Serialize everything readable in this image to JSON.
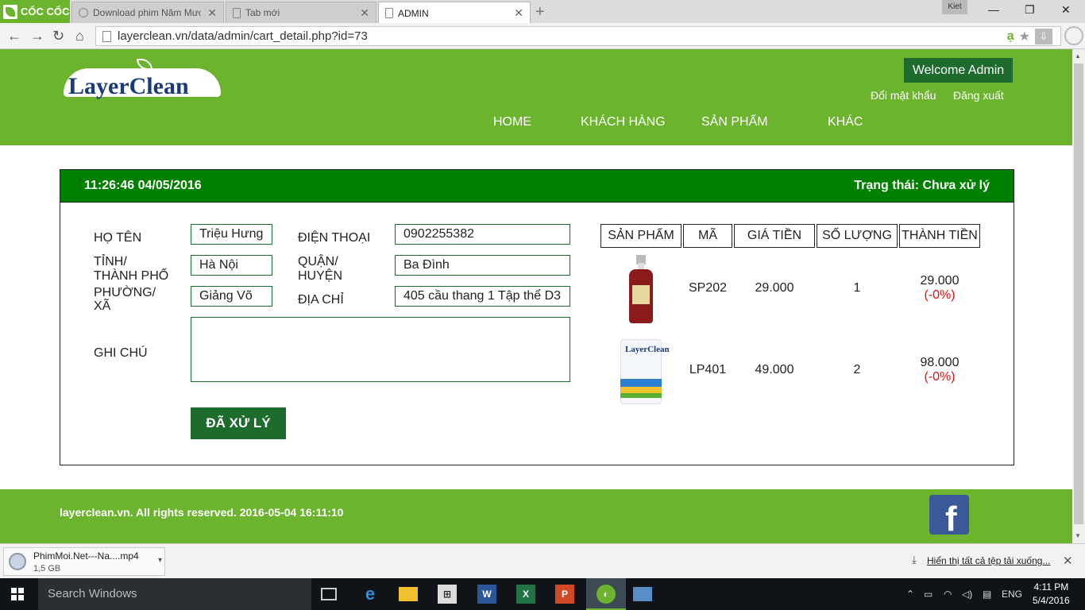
{
  "browser": {
    "brand": "CỐC CỐC",
    "tabs": [
      {
        "label": "Download phim Năm Mươ"
      },
      {
        "label": "Tab mới"
      },
      {
        "label": "ADMIN"
      }
    ],
    "user_badge": "Kiet",
    "url": "layerclean.vn/data/admin/cart_detail.php?id=73"
  },
  "site": {
    "logo_text": "LayerClean",
    "welcome": "Welcome Admin",
    "account_links": {
      "change_password": "Đổi mật khẩu",
      "logout": "Đăng xuất"
    },
    "nav": {
      "home": "HOME",
      "customers": "KHÁCH HÀNG",
      "products": "SẢN PHẨM",
      "other": "KHÁC"
    }
  },
  "order": {
    "timestamp": "11:26:46 04/05/2016",
    "status": "Trạng thái: Chưa xử lý",
    "labels": {
      "name": "HỌ TÊN",
      "phone": "ĐIỆN THOẠI",
      "province_1": "TỈNH/",
      "province_2": "THÀNH PHỐ",
      "district_1": "QUẬN/",
      "district_2": "HUYỆN",
      "ward_1": "PHƯỜNG/",
      "ward_2": "XÃ",
      "address": "ĐỊA CHỈ",
      "note": "GHI CHÚ"
    },
    "values": {
      "name": "Triệu Hưng",
      "phone": "0902255382",
      "province": "Hà Nội",
      "district": "Ba Đình",
      "ward": "Giảng Võ",
      "address": "405 cầu thang 1 Tập thể D3",
      "note": ""
    },
    "done_button": "ĐÃ XỬ LÝ",
    "table": {
      "headers": [
        "SẢN PHẨM",
        "MÃ",
        "GIÁ TIỀN",
        "SỐ LƯỢNG",
        "THÀNH TIỀN"
      ],
      "rows": [
        {
          "code": "SP202",
          "price": "29.000",
          "qty": "1",
          "total": "29.000",
          "discount": "(-0%)"
        },
        {
          "code": "LP401",
          "price": "49.000",
          "qty": "2",
          "total": "98.000",
          "discount": "(-0%)"
        }
      ]
    }
  },
  "footer": {
    "text": "layerclean.vn. All rights reserved. 2016-05-04 16:11:10",
    "social": "f"
  },
  "downloads": {
    "file_name": "PhimMoi.Net---Na....mp4",
    "file_size": "1,5 GB",
    "show_all": "Hiển thị tất cả tệp tải xuống..."
  },
  "taskbar": {
    "search": "Search Windows",
    "lang": "ENG",
    "time": "4:11 PM",
    "date": "5/4/2016"
  },
  "colors": {
    "brand_green": "#6cb32e",
    "dark_green": "#1e6b2e",
    "panel_head": "#008000",
    "discount_red": "#dd1111"
  }
}
